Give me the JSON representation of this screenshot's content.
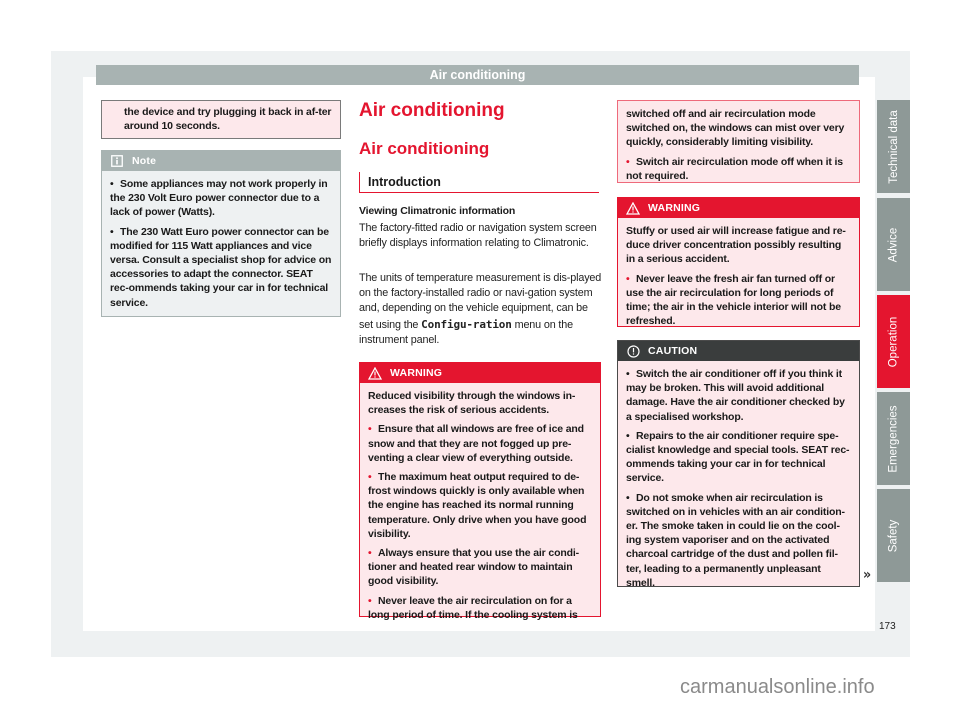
{
  "header": {
    "title": "Air conditioning"
  },
  "column1": {
    "continued_box": {
      "text": "the device and try plugging it back in af-ter around 10 seconds."
    },
    "note": {
      "icon": "info-icon",
      "label": "Note",
      "items": [
        "Some appliances may not work properly in the 230 Volt Euro power connector due to a lack of power (Watts).",
        "The 230 Watt Euro power connector can be modified for 115 Watt appliances and vice versa. Consult a specialist shop for advice on accessories to adapt the connector. SEAT rec-ommends taking your car in for technical service."
      ]
    }
  },
  "column2": {
    "chapter_title": "Air conditioning",
    "section_title": "Air conditioning",
    "subsection_title": "Introduction",
    "topic_title": "Viewing Climatronic information",
    "paragraph1": "The factory-fitted radio or navigation system screen briefly displays information relating to Climatronic.",
    "paragraph2_pre": "The units of temperature measurement is dis-played on the factory-installed radio or navi-gation system and, depending on the vehicle equipment, can be set using the ",
    "paragraph2_menu": "Configu-ration",
    "paragraph2_post": " menu on the instrument panel.",
    "warning": {
      "icon": "warning-triangle-icon",
      "label": "WARNING",
      "intro": "Reduced visibility through the windows in-creases the risk of serious accidents.",
      "items": [
        "Ensure that all windows are free of ice and snow and that they are not fogged up pre-venting a clear view of everything outside.",
        "The maximum heat output required to de-frost windows quickly is only available when the engine has reached its normal running temperature. Only drive when you have good visibility.",
        "Always ensure that you use the air condi-tioner and heated rear window to maintain good visibility.",
        "Never leave the air recirculation on for a long period of time. If the cooling system is"
      ]
    }
  },
  "column3": {
    "warning_continued": {
      "intro": "switched off and air recirculation mode switched on, the windows can mist over very quickly, considerably limiting visibility.",
      "items": [
        "Switch air recirculation mode off when it is not required."
      ]
    },
    "warning2": {
      "icon": "warning-triangle-icon",
      "label": "WARNING",
      "intro": "Stuffy or used air will increase fatigue and re-duce driver concentration possibly resulting in a serious accident.",
      "items": [
        "Never leave the fresh air fan turned off or use the air recirculation for long periods of time; the air in the vehicle interior will not be refreshed."
      ]
    },
    "caution": {
      "icon": "caution-icon",
      "label": "CAUTION",
      "items": [
        "Switch the air conditioner off if you think it may be broken. This will avoid additional damage. Have the air conditioner checked by a specialised workshop.",
        "Repairs to the air conditioner require spe-cialist knowledge and special tools. SEAT rec-ommends taking your car in for technical service.",
        "Do not smoke when air recirculation is switched on in vehicles with an air condition-er. The smoke taken in could lie on the cool-ing system vaporiser and on the activated charcoal cartridge of the dust and pollen fil-ter, leading to a permanently unpleasant smell."
      ]
    },
    "continue_mark": "»"
  },
  "side_tabs": [
    {
      "label": "Technical data",
      "active": false
    },
    {
      "label": "Advice",
      "active": false
    },
    {
      "label": "Operation",
      "active": true
    },
    {
      "label": "Emergencies",
      "active": false
    },
    {
      "label": "Safety",
      "active": false
    }
  ],
  "page_number": "173",
  "watermark": "carmanualsonline.info",
  "colors": {
    "accent": "#e4152f",
    "header_bar": "#a8b3b2",
    "tab_gray": "#8e9997",
    "caution_head": "#3a3d3d",
    "box_pink": "#fde8eb"
  }
}
